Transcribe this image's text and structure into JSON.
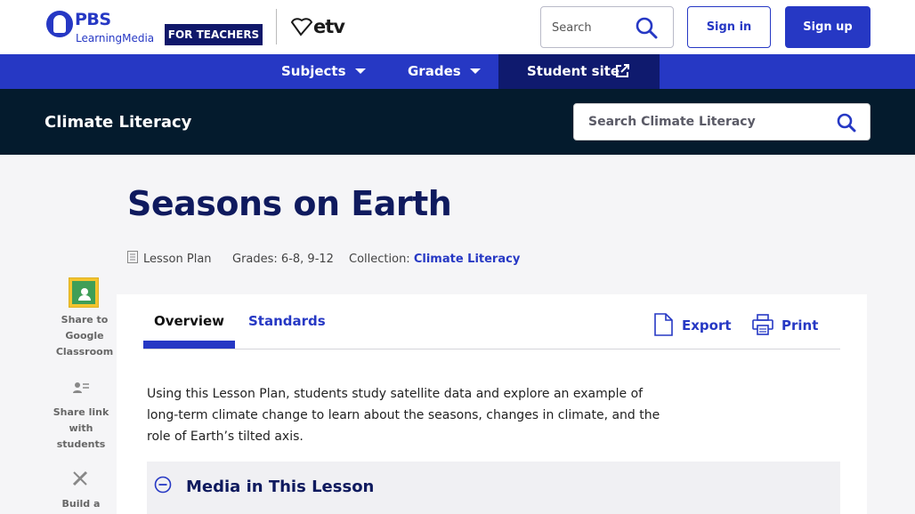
{
  "header": {
    "brand_name": "PBS",
    "brand_sub": "LearningMedia",
    "audience_badge": "FOR TEACHERS",
    "partner_logo": "etv",
    "search_placeholder": "Search",
    "sign_in_label": "Sign in",
    "sign_up_label": "Sign up"
  },
  "nav": {
    "subjects_label": "Subjects",
    "grades_label": "Grades",
    "student_site_label": "Student site"
  },
  "collection": {
    "title": "Climate Literacy",
    "search_placeholder": "Search Climate Literacy"
  },
  "page": {
    "title": "Seasons on Earth",
    "resource_type": "Lesson Plan",
    "grades": "Grades: 6-8, 9-12",
    "collection_label": "Collection:",
    "collection_link": "Climate Literacy"
  },
  "share": {
    "google_classroom_label": "Share to Google Classroom",
    "share_link_label": "Share link with students",
    "build_label": "Build a"
  },
  "tabs": {
    "overview_label": "Overview",
    "standards_label": "Standards"
  },
  "actions": {
    "export_label": "Export",
    "print_label": "Print"
  },
  "content": {
    "description": "Using this Lesson Plan, students study satellite data and explore an example of long-term climate change to learn about the seasons, changes in climate, and the role of Earth’s tilted axis.",
    "media_section_title": "Media in This Lesson"
  },
  "colors": {
    "brand_blue": "#2638c4",
    "navy": "#0f1a5e",
    "collection_bar": "#041b2d"
  }
}
